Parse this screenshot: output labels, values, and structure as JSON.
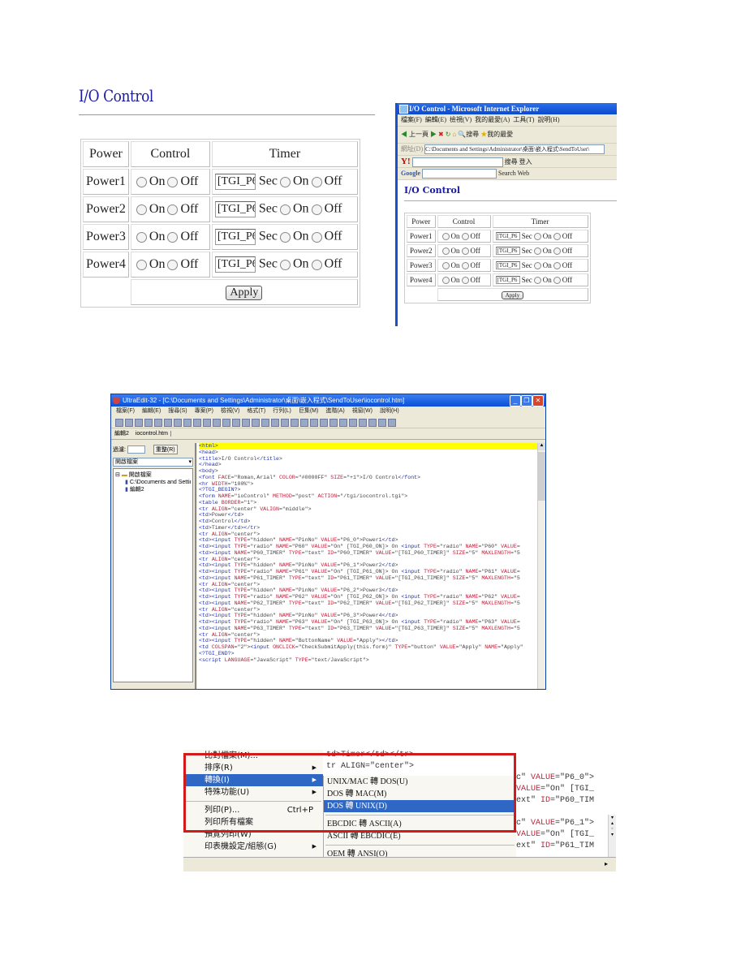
{
  "io_control_page": {
    "title": "I/O Control",
    "headers": [
      "Power",
      "Control",
      "Timer"
    ],
    "rows": [
      {
        "label": "Power1",
        "on": "On",
        "off": "Off",
        "timer_value": "[TGI_P6",
        "sec": "Sec",
        "t_on": "On",
        "t_off": "Off"
      },
      {
        "label": "Power2",
        "on": "On",
        "off": "Off",
        "timer_value": "[TGI_P6",
        "sec": "Sec",
        "t_on": "On",
        "t_off": "Off"
      },
      {
        "label": "Power3",
        "on": "On",
        "off": "Off",
        "timer_value": "[TGI_P6",
        "sec": "Sec",
        "t_on": "On",
        "t_off": "Off"
      },
      {
        "label": "Power4",
        "on": "On",
        "off": "Off",
        "timer_value": "[TGI_P6",
        "sec": "Sec",
        "t_on": "On",
        "t_off": "Off"
      }
    ],
    "apply_label": "Apply"
  },
  "ie_window": {
    "title": "I/O Control - Microsoft Internet Explorer",
    "menu": [
      "檔案(F)",
      "編輯(E)",
      "檢視(V)",
      "我的最愛(A)",
      "工具(T)",
      "說明(H)"
    ],
    "toolbar": {
      "back": "上一頁",
      "search": "搜尋",
      "favorites": "我的最愛"
    },
    "address_label": "網址(D)",
    "address": "C:\\Documents and Settings\\Administrator\\桌面\\嵌入程式\\SendToUser\\",
    "yahoo_bar": {
      "logo": "Y!",
      "search": "搜尋",
      "login": "登入"
    },
    "google_bar": {
      "logo": "Google",
      "search_web": "Search Web"
    }
  },
  "ultraedit": {
    "title": "UltraEdit-32 - [C:\\Documents and Settings\\Administrator\\桌面\\嵌入程式\\SendToUser\\iocontrol.htm]",
    "menu": [
      "檔案(F)",
      "編輯(E)",
      "搜尋(S)",
      "專案(P)",
      "檢視(V)",
      "格式(T)",
      "行列(L)",
      "巨集(M)",
      "進階(A)",
      "視窗(W)",
      "說明(H)"
    ],
    "tabs": [
      "編輯2",
      "iocontrol.htm"
    ],
    "left_panel": {
      "filter_label": "過濾:",
      "refresh_button": "重整(R)",
      "dropdown": "開啟檔案",
      "tree": [
        "開啟檔案",
        "C:\\Documents and Settings\\A",
        "編輯2"
      ]
    },
    "code_lines": [
      "<html>",
      "<head>",
      "<title>I/O Control</title>",
      "</head>",
      "<body>",
      "<font FACE=\"Roman,Arial\" COLOR=\"#0000FF\" SIZE=\"+1\">I/O Control</font>",
      "<hr WIDTH=\"100%\">",
      "<?TGI_BEGIN?>",
      "<form NAME=\"ioControl\" METHOD=\"post\" ACTION=\"/tgi/iocontrol.tgi\">",
      "<table BORDER=\"1\">",
      "<tr ALIGN=\"center\" VALIGN=\"middle\">",
      "<td>Power</td>",
      "<td>Control</td>",
      "<td>Timer</td></tr>",
      "<tr ALIGN=\"center\">",
      "<td><input TYPE=\"hidden\" NAME=\"PinNo\" VALUE=\"P6_0\">Power1</td>",
      "<td><input TYPE=\"radio\" NAME=\"P60\" VALUE=\"On\" [TGI_P60_ON]> On <input TYPE=\"radio\" NAME=\"P60\" VALUE=",
      "<td><input NAME=\"P60_TIMER\" TYPE=\"text\" ID=\"P60_TIMER\" VALUE=\"[TGI_P60_TIMER]\" SIZE=\"5\" MAXLENGTH=\"5",
      "<tr ALIGN=\"center\">",
      "<td><input TYPE=\"hidden\" NAME=\"PinNo\" VALUE=\"P6_1\">Power2</td>",
      "<td><input TYPE=\"radio\" NAME=\"P61\" VALUE=\"On\" [TGI_P61_ON]> On <input TYPE=\"radio\" NAME=\"P61\" VALUE=",
      "<td><input NAME=\"P61_TIMER\" TYPE=\"text\" ID=\"P61_TIMER\" VALUE=\"[TGI_P61_TIMER]\" SIZE=\"5\" MAXLENGTH=\"5",
      "<tr ALIGN=\"center\">",
      "<td><input TYPE=\"hidden\" NAME=\"PinNo\" VALUE=\"P6_2\">Power3</td>",
      "<td><input TYPE=\"radio\" NAME=\"P62\" VALUE=\"On\" [TGI_P62_ON]> On <input TYPE=\"radio\" NAME=\"P62\" VALUE=",
      "<td><input NAME=\"P62_TIMER\" TYPE=\"text\" ID=\"P62_TIMER\" VALUE=\"[TGI_P62_TIMER]\" SIZE=\"5\" MAXLENGTH=\"5",
      "<tr ALIGN=\"center\">",
      "<td><input TYPE=\"hidden\" NAME=\"PinNo\" VALUE=\"P6_3\">Power4</td>",
      "<td><input TYPE=\"radio\" NAME=\"P63\" VALUE=\"On\" [TGI_P63_ON]> On <input TYPE=\"radio\" NAME=\"P63\" VALUE=",
      "<td><input NAME=\"P63_TIMER\" TYPE=\"text\" ID=\"P63_TIMER\" VALUE=\"[TGI_P63_TIMER]\" SIZE=\"5\" MAXLENGTH=\"5",
      "<tr ALIGN=\"center\">",
      "<td><input TYPE=\"hidden\" NAME=\"ButtonName\" VALUE=\"Apply\"></td>",
      "<td COLSPAN=\"2\"><input ONCLICK=\"CheckSubmitApply(this.form)\" TYPE=\"button\" VALUE=\"Apply\" NAME=\"Apply\"",
      "<?TGI_END?>",
      "<script LANGUAGE=\"JavaScript\" TYPE=\"text/JavaScript\">"
    ]
  },
  "context_menu": {
    "items": [
      {
        "label": "比對檔案(M)...",
        "submenu": false
      },
      {
        "label": "排序(R)",
        "submenu": true
      },
      {
        "label": "轉換(I)",
        "submenu": true,
        "active": true
      },
      {
        "label": "特殊功能(U)",
        "submenu": true
      },
      {
        "label": "列印(P)...",
        "shortcut": "Ctrl+P",
        "separator_before": true
      },
      {
        "label": "列印所有檔案",
        "submenu": false
      },
      {
        "label": "預覽列印(W)",
        "submenu": false
      },
      {
        "label": "印表機設定/組態(G)",
        "submenu": true
      }
    ],
    "submenu_items": [
      {
        "label": "UNIX/MAC 轉 DOS(U)"
      },
      {
        "label": "DOS 轉 MAC(M)"
      },
      {
        "label": "DOS 轉 UNIX(D)",
        "active": true
      },
      {
        "label": "EBCDIC 轉 ASCII(A)",
        "separator_before": true
      },
      {
        "label": "ASCII 轉 EBCDIC(E)"
      },
      {
        "label": "OEM 轉 ANSI(O)",
        "separator_before": true
      }
    ],
    "bg_code_top": [
      "td>Timer</td></tr>",
      "tr ALIGN=\"center\">"
    ],
    "bg_code_right": [
      "c\" VALUE=\"P6_0\">",
      "VALUE=\"On\" [TGI_",
      "ext\" ID=\"P60_TIM",
      "",
      "c\" VALUE=\"P6_1\">",
      "VALUE=\"On\" [TGI_",
      "ext\" ID=\"P61_TIM"
    ]
  }
}
